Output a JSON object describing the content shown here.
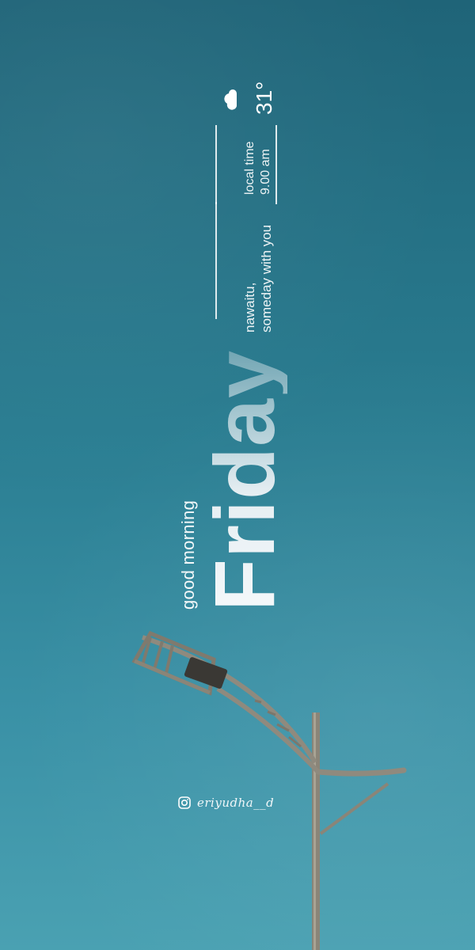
{
  "greeting": "good morning",
  "day": "Friday",
  "motto": {
    "line1": "nawaitu,",
    "line2": "someday with you"
  },
  "time": {
    "label": "local time",
    "value": "9.00 am"
  },
  "weather": {
    "temperature": "31°",
    "icon": "cloud-icon"
  },
  "credit": {
    "icon": "instagram-icon",
    "handle": "eriyudha__d"
  },
  "colors": {
    "sky_top": "#1f6478",
    "sky_bottom": "#4aa1b2",
    "text": "#ffffff"
  }
}
